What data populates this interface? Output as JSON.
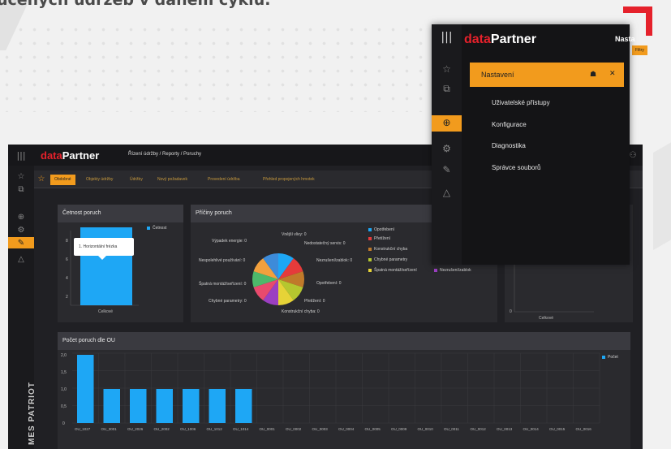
{
  "header_text": "učených údržeb v daném cyklu.",
  "brand": {
    "prefix": "data",
    "suffix": "Partner",
    "color": "#e5212b"
  },
  "side_label": "MES PATRIOT",
  "breadcrumb": "Řízení údržby / Reporty / Poruchy",
  "tabs": [
    "Obdobné",
    "Objekty údržby",
    "Údržby",
    "Nový požadavek",
    "Provedení údržba",
    "Přehled propojených hmotek"
  ],
  "filter_label": "Filtry",
  "chart_freq": {
    "title": "Četnost poruch",
    "legend": "Četnost",
    "category": "Celkové",
    "y_ticks": [
      "8",
      "6",
      "4",
      "2",
      "0"
    ]
  },
  "chart_causes": {
    "title": "Příčiny poruch",
    "labels": [
      "Vnější vlivy: 0",
      "Nedostatečný servis: 0",
      "Nezrušení/zablok: 0",
      "Opotřebení: 0",
      "Přetížení: 0",
      "Konstrukční chyba: 0",
      "Chybné parametry: 0",
      "Špatná montáž/seřízení: 0",
      "Nespolehlivé používání: 0",
      "Výpadek energie: 0"
    ],
    "legend": [
      "Opotřebení",
      "Přetížení",
      "Konstrukční chyba",
      "Chybné parametry",
      "Špatná montáž/seřízení",
      "Nezrušení/zablok"
    ]
  },
  "chart_third": {
    "category": "Celkové",
    "y_zero": "0"
  },
  "chart_ou": {
    "title": "Počet poruch dle OU",
    "legend": "Počet",
    "y_ticks": [
      "2,0",
      "1,5",
      "1,0",
      "0,5",
      "0"
    ],
    "tooltip": "1. Horizontální frézka"
  },
  "menu": {
    "brand_suffix": "Partner",
    "top_partial": "Nasta",
    "header": "Nastavení",
    "items": [
      "Uživatelské přístupy",
      "Konfigurace",
      "Diagnostika",
      "Správce souborů"
    ]
  },
  "chart_data": [
    {
      "type": "bar",
      "title": "Četnost poruch",
      "categories": [
        "Celkové"
      ],
      "series": [
        {
          "name": "Četnost",
          "values": [
            8
          ]
        }
      ],
      "ylim": [
        0,
        9
      ]
    },
    {
      "type": "pie",
      "title": "Příčiny poruch",
      "categories": [
        "Opotřebení",
        "Přetížení",
        "Konstrukční chyba",
        "Chybné parametry",
        "Špatná montáž/seřízení",
        "Nezrušení/zablok"
      ],
      "values": [
        1,
        1,
        1,
        1,
        1,
        1
      ]
    },
    {
      "type": "bar",
      "title": "Počet poruch dle OU",
      "categories": [
        "OU_1027",
        "OU_3001",
        "OU_2026",
        "OU_2002",
        "OU_1006",
        "OU_1012",
        "OU_1014",
        "OU_0001",
        "OU_0002",
        "OU_0003",
        "OU_0004",
        "OU_0005",
        "OU_0009",
        "OU_0010",
        "OU_0011",
        "OU_0012",
        "OU_0013",
        "OU_0014",
        "OU_0015",
        "OU_0016"
      ],
      "series": [
        {
          "name": "Počet",
          "values": [
            2,
            1,
            1,
            1,
            1,
            1,
            1,
            0,
            0,
            0,
            0,
            0,
            0,
            0,
            0,
            0,
            0,
            0,
            0,
            0
          ]
        }
      ],
      "ylim": [
        0,
        2
      ]
    }
  ],
  "colors": {
    "accent": "#f29b1d",
    "bar": "#1ea7f5"
  }
}
